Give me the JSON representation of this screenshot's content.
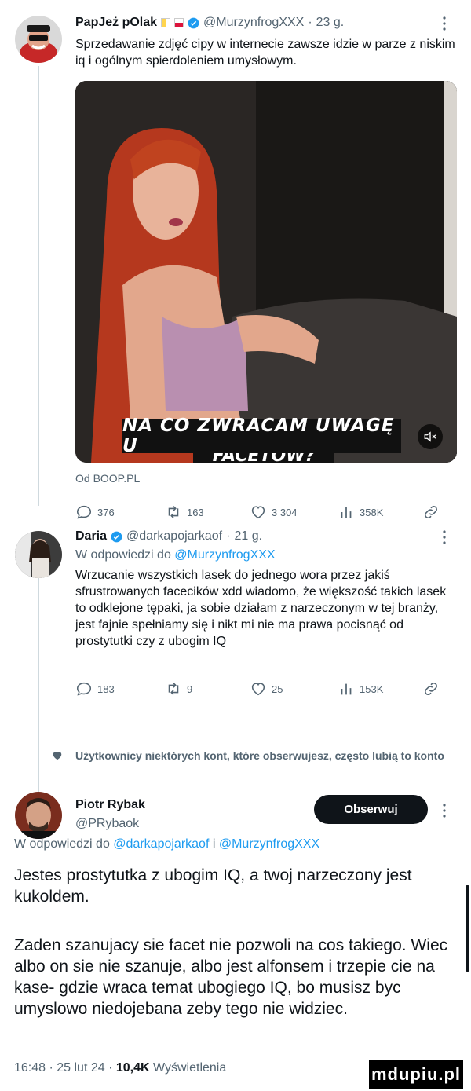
{
  "post1": {
    "name": "PapJeż pOlak",
    "handle": "@MurzynfrogXXX",
    "age": "23 g.",
    "text": "Sprzedawanie zdjęć cipy w internecie zawsze idzie w parze z niskim iq i ogólnym spierdoleniem umysłowym.",
    "media_caption": "NA CO ZWRACAM UWAGĘ U",
    "media_caption_cut": "FACETÓW?",
    "source_label": "Od BOOP.PL",
    "stats": {
      "replies": "376",
      "reposts": "163",
      "likes": "3 304",
      "views": "358K"
    }
  },
  "post2": {
    "name": "Daria",
    "handle": "@darkapojarkaof",
    "age": "21 g.",
    "reply_prefix": "W odpowiedzi do",
    "reply_to": "@MurzynfrogXXX",
    "text": "Wrzucanie wszystkich lasek do jednego wora przez jakiś sfrustrowanych facecików xdd wiadomo, że większość takich lasek to odklejone tępaki, ja sobie działam z narzeczonym w tej branży, jest fajnie spełniamy się i nikt mi nie ma prawa pocisnąć od prostytutki czy z ubogim IQ",
    "stats": {
      "replies": "183",
      "reposts": "9",
      "likes": "25",
      "views": "153K"
    }
  },
  "notice": "Użytkownicy niektórych kont, które obserwujesz, często lubią to konto",
  "post3": {
    "name": "Piotr Rybak",
    "handle": "@PRybaok",
    "follow_label": "Obserwuj",
    "reply_prefix": "W odpowiedzi do",
    "reply_to_1": "@darkapojarkaof",
    "reply_join": "i",
    "reply_to_2": "@MurzynfrogXXX",
    "text_p1": "Jestes prostytutka z ubogim IQ, a twoj narzeczony jest kukoldem.",
    "text_p2": "Zaden szanujacy sie facet nie pozwoli na cos takiego. Wiec albo on sie nie szanuje, albo jest alfonsem i trzepie cie na kase- gdzie wraca temat ubogiego IQ, bo musisz byc umyslowo niedojebana zeby tego nie widziec.",
    "time": "16:48 · 25 lut 24 ·",
    "views": "10,4K",
    "views_label": "Wyświetlenia"
  },
  "watermark": "mdupiu.pl",
  "colors": {
    "accent": "#1d9bf0",
    "muted": "#536471",
    "text": "#0f1419",
    "line": "#cfd9de"
  },
  "icons": [
    "verified-badge-icon",
    "more-icon",
    "reply-icon",
    "repost-icon",
    "like-icon",
    "views-icon",
    "share-icon",
    "heart-icon",
    "mute-icon"
  ]
}
